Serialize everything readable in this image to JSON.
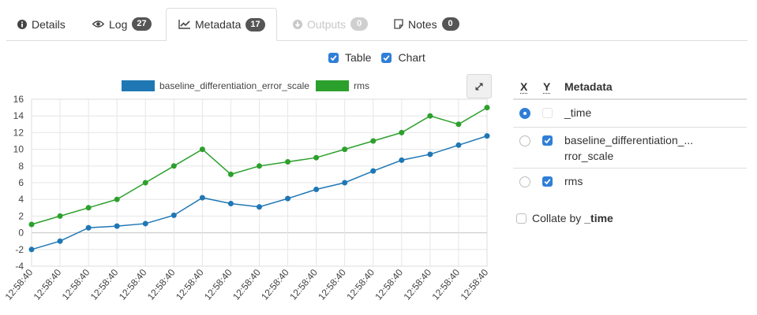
{
  "tabs": [
    {
      "id": "details",
      "label": "Details",
      "icon": "info-circle-icon",
      "badge": null,
      "active": false,
      "disabled": false
    },
    {
      "id": "log",
      "label": "Log",
      "icon": "eye-icon",
      "badge": "27",
      "active": false,
      "disabled": false
    },
    {
      "id": "metadata",
      "label": "Metadata",
      "icon": "line-chart-icon",
      "badge": "17",
      "active": true,
      "disabled": false
    },
    {
      "id": "outputs",
      "label": "Outputs",
      "icon": "circle-arrow-icon",
      "badge": "0",
      "active": false,
      "disabled": true
    },
    {
      "id": "notes",
      "label": "Notes",
      "icon": "note-icon",
      "badge": "0",
      "active": false,
      "disabled": false
    }
  ],
  "view_toggles": {
    "table": {
      "label": "Table",
      "checked": true
    },
    "chart": {
      "label": "Chart",
      "checked": true
    }
  },
  "metadata_table": {
    "headers": {
      "x": "X",
      "y": "Y",
      "name": "Metadata"
    },
    "rows": [
      {
        "name": "_time",
        "x_selected": true,
        "y_checked": false,
        "y_disabled": true
      },
      {
        "name_line1": "baseline_differentiation_...",
        "name_line2": "rror_scale",
        "x_selected": false,
        "y_checked": true
      },
      {
        "name": "rms",
        "x_selected": false,
        "y_checked": true
      }
    ]
  },
  "collate": {
    "label": "Collate by",
    "field": "_time",
    "checked": false
  },
  "colors": {
    "accent": "#2f7fd8",
    "series_blue": "#1f77b4",
    "series_green": "#2ca02c",
    "badge": "#555555"
  },
  "chart_data": {
    "type": "line",
    "legend_position": "top",
    "grid": true,
    "x": [
      "12:58:40",
      "12:58:40",
      "12:58:40",
      "12:58:40",
      "12:58:40",
      "12:58:40",
      "12:58:40",
      "12:58:40",
      "12:58:40",
      "12:58:40",
      "12:58:40",
      "12:58:40",
      "12:58:40",
      "12:58:40",
      "12:58:40",
      "12:58:40"
    ],
    "ylim": [
      -4,
      16
    ],
    "yticks": [
      -4,
      -2,
      0,
      2,
      4,
      6,
      8,
      10,
      12,
      14,
      16
    ],
    "series": [
      {
        "name": "baseline_differentiation_error_scale",
        "color": "#1f77b4",
        "values": [
          -2.0,
          -1.0,
          0.6,
          0.8,
          1.1,
          2.1,
          4.2,
          3.5,
          3.1,
          4.1,
          5.2,
          6.0,
          7.4,
          8.7,
          9.4,
          10.5,
          11.6
        ]
      },
      {
        "name": "rms",
        "color": "#2ca02c",
        "values": [
          1.0,
          2.0,
          3.0,
          4.0,
          6.0,
          8.0,
          10.0,
          7.0,
          8.0,
          8.5,
          9.0,
          10.0,
          11.0,
          12.0,
          14.0,
          13.0,
          15.0
        ]
      }
    ]
  }
}
